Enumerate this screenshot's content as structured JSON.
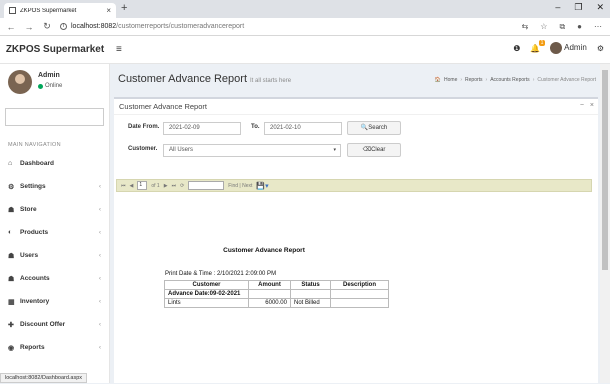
{
  "browser": {
    "tab_title": "ZKPOS Supermarket",
    "url_host": "localhost:8082",
    "url_path": "/customerreports/customeradvancereport",
    "status_url": "localhost:8082/Dashboard.aspx"
  },
  "header": {
    "app_name": "ZKPOS Supermarket",
    "notification_count": "1",
    "user_label": "Admin"
  },
  "sidebar": {
    "user_name": "Admin",
    "user_status": "Online",
    "nav_header": "MAIN NAVIGATION",
    "items": [
      {
        "label": "Dashboard",
        "icon": "dashboard-icon"
      },
      {
        "label": "Settings",
        "icon": "gear-icon"
      },
      {
        "label": "Store",
        "icon": "store-icon"
      },
      {
        "label": "Products",
        "icon": "products-icon"
      },
      {
        "label": "Users",
        "icon": "users-icon"
      },
      {
        "label": "Accounts",
        "icon": "accounts-icon"
      },
      {
        "label": "Inventory",
        "icon": "inventory-icon"
      },
      {
        "label": "Discount Offer",
        "icon": "plus-icon"
      },
      {
        "label": "Reports",
        "icon": "reports-icon"
      }
    ]
  },
  "page": {
    "title": "Customer Advance Report",
    "subtitle": "It all starts here",
    "breadcrumb": [
      "Home",
      "Reports",
      "Accounts Reports",
      "Customer Advance Report"
    ]
  },
  "box": {
    "title": "Customer Advance Report"
  },
  "form": {
    "date_from_label": "Date From.",
    "date_from_value": "2021-02-09",
    "to_label": "To.",
    "to_value": "2021-02-10",
    "search_label": "Search",
    "customer_label": "Customer.",
    "customer_value": "All Users",
    "clear_label": "Clear"
  },
  "toolbar": {
    "page_value": "1",
    "page_of": "of 1",
    "find_label": "Find | Next"
  },
  "report": {
    "title": "Customer Advance Report",
    "print_date": "Print Date & Time : 2/10/2021 2:09:00 PM",
    "columns": [
      "Customer",
      "Amount",
      "Status",
      "Description"
    ],
    "group_row": "Advance Date:09-02-2021",
    "rows": [
      {
        "customer": "Lints",
        "amount": "6000.00",
        "status": "Not Billed",
        "description": ""
      }
    ]
  }
}
